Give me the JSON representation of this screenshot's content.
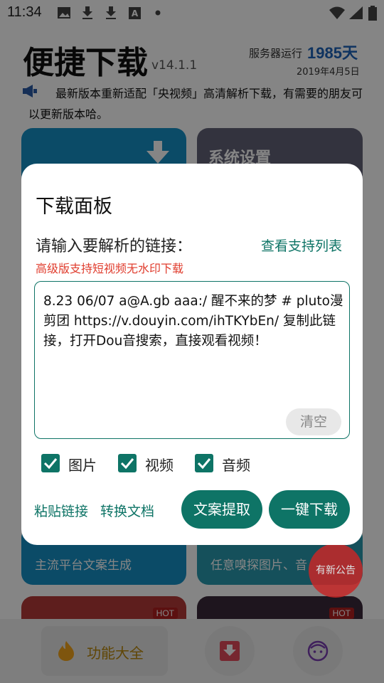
{
  "status_bar": {
    "time": "11:34",
    "icons": [
      "image-icon",
      "download-icon",
      "download-icon",
      "text-a-icon",
      "dot-icon",
      "wifi-icon",
      "signal-icon",
      "battery-icon"
    ]
  },
  "app": {
    "title": "便捷下载",
    "version": "v14.1.1",
    "server_label": "服务器运行",
    "server_days": "1985天",
    "server_date": "2019年4月5日",
    "notice": "最新版本重新适配「央视频」高清解析下载，有需要的朋友可以更新版本哈。",
    "cards": {
      "settings_title": "系统设置",
      "card3_sub": "主流平台文案生成",
      "card4_sub": "任意嗅探图片、音",
      "hot_badge": "HOT"
    },
    "news_button": "有新公告",
    "bottom_nav": {
      "main_label": "功能大全"
    }
  },
  "dialog": {
    "title": "下载面板",
    "prompt": "请输入要解析的链接：",
    "support_link": "查看支持列表",
    "subnote": "高级版支持短视频无水印下载",
    "input_text": "8.23 06/07 a@A.gb aaa:/ 醒不来的梦 # pluto漫剪团  https://v.douyin.com/ihTKYbEn/ 复制此链接，打开Dou音搜索，直接观看视频！",
    "clear_label": "清空",
    "checkboxes": [
      {
        "label": "图片",
        "checked": true
      },
      {
        "label": "视频",
        "checked": true
      },
      {
        "label": "音频",
        "checked": true
      }
    ],
    "paste_label": "粘贴链接",
    "convert_label": "转换文档",
    "extract_label": "文案提取",
    "download_label": "一键下载"
  },
  "colors": {
    "accent": "#0e7466",
    "warning": "#e03d2e",
    "days": "#1e63b8",
    "news_fab": "#c62828"
  }
}
